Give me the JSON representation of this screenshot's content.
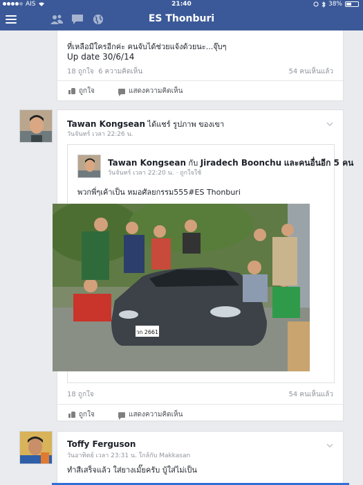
{
  "status_bar": {
    "carrier": "AIS",
    "time": "21:40",
    "battery": "38%"
  },
  "nav": {
    "title": "ES Thonburi"
  },
  "post1": {
    "line1": "ที่เหลือมีใครอีกค่ะ  คนจับได้ช่วยแจ้งด้วยนะ...จุ๊บๆ",
    "line2": "Up date  30/6/14",
    "likes": "18 ถูกใจ",
    "comments": "6 ความคิดเห็น",
    "seen": "54 คนเห็นแล้ว",
    "like_label": "ถูกใจ",
    "comment_label": "แสดงความคิดเห็น"
  },
  "post2": {
    "author": "Tawan Kongsean",
    "action": "ได้แชร์ รูปภาพ ของเขา",
    "time": "วันจันทร์ เวลา 22:26 น.",
    "shared": {
      "author": "Tawan Kongsean",
      "with": "กับ",
      "tagged": "Jiradech Boonchu",
      "others": "และคนอื่นอีก 5 คน",
      "time": "วันจันทร์ เวลา 22:20 น. · ถูกใจใช้",
      "text": "พวกพี่ๆเค้าเป็น หมอศัลยกรรม555#ES Thonburi",
      "plate": "วก 2661"
    },
    "likes": "18 ถูกใจ",
    "seen": "54 คนเห็นแล้ว",
    "like_label": "ถูกใจ",
    "comment_label": "แสดงความคิดเห็น"
  },
  "post3": {
    "author": "Toffy Ferguson",
    "time": "วันอาทิตย์ เวลา 23:31 น. ใกล้กับ Makkasan",
    "text": "ทำสีเสร็จแล้ว ใส่ยางเมั๊ยครับ บู้ใส่ไม่เป็น"
  },
  "colors": {
    "brand": "#3b5998",
    "background": "#e9ebee"
  }
}
